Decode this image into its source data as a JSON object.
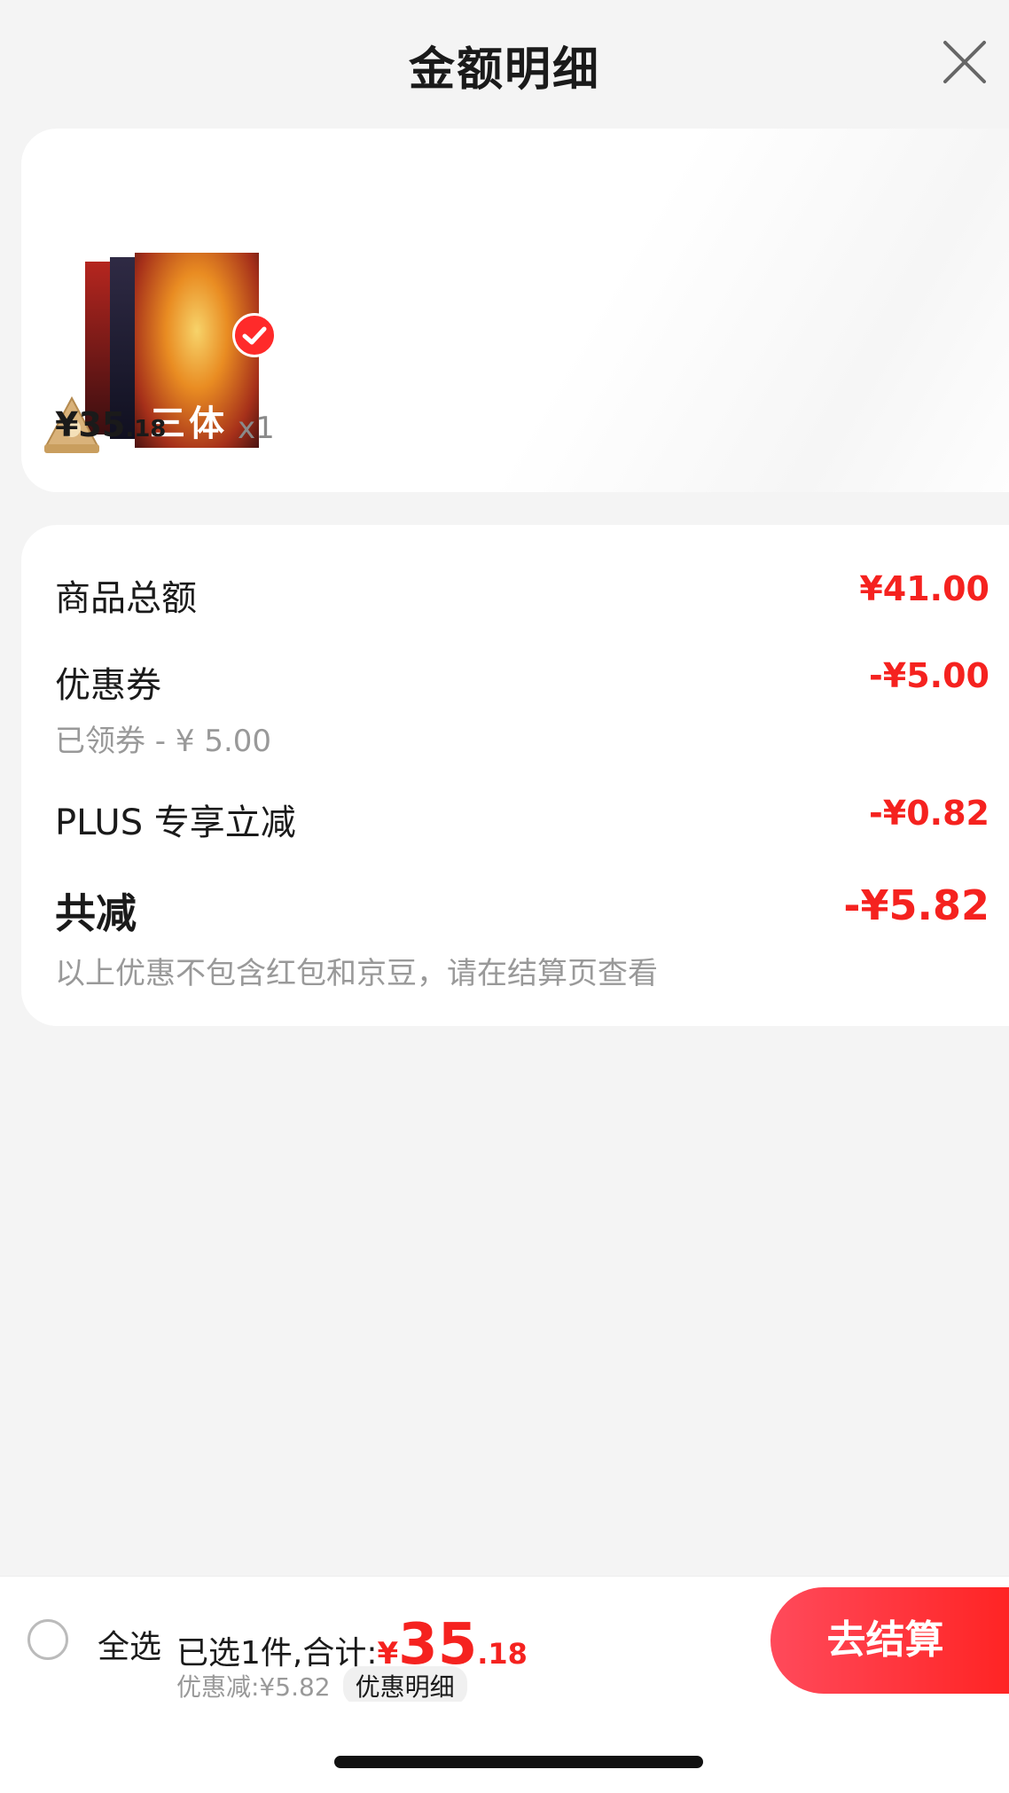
{
  "header": {
    "title": "金额明细",
    "close_icon": "close-icon"
  },
  "product": {
    "cover_title": "三体",
    "price_main": "¥35",
    "price_decimal": ".18",
    "quantity": "x1",
    "selected": true
  },
  "summary": {
    "items_total_label": "商品总额",
    "items_total_value": "¥41.00",
    "coupon_label": "优惠券",
    "coupon_value": "-¥5.00",
    "coupon_sub": "已领券 - ¥ 5.00",
    "plus_label": "PLUS 专享立减",
    "plus_value": "-¥0.82",
    "total_label": "共减",
    "total_value": "-¥5.82",
    "note": "以上优惠不包含红包和京豆，请在结算页查看"
  },
  "bottom_bar": {
    "select_all": "全选",
    "selected_text": "已选1件,合计:",
    "total_yen": "¥",
    "total_int": "35",
    "total_dec": ".18",
    "discount_text": "优惠减:¥5.82",
    "detail_link": "优惠明细",
    "checkout": "去结算"
  },
  "colors": {
    "accent": "#f5221f",
    "background": "#f4f4f4",
    "card": "#ffffff"
  }
}
